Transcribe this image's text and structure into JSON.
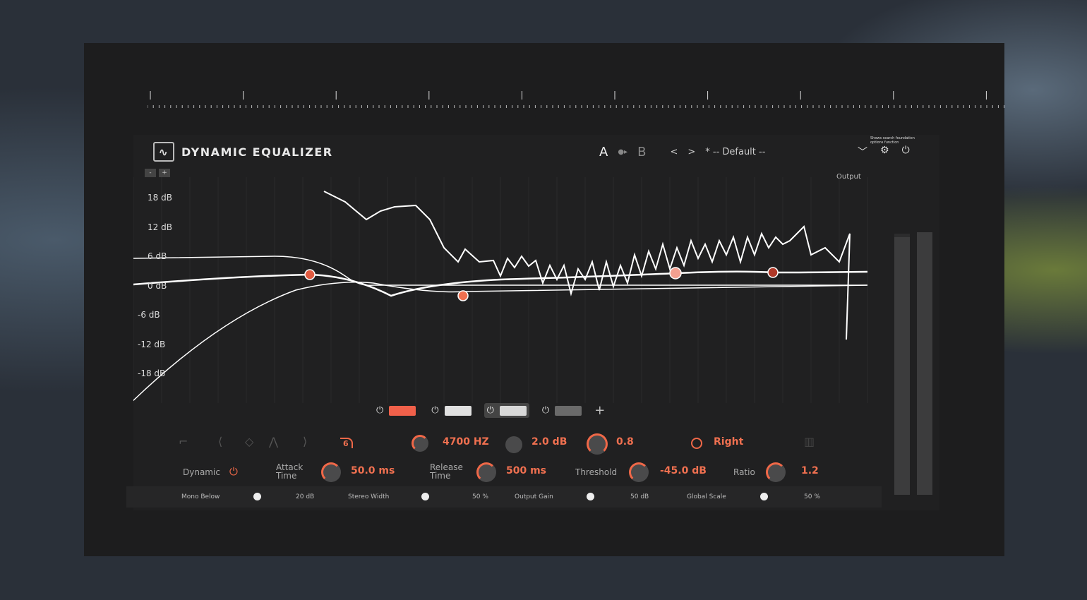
{
  "app": {
    "title": "DYNAMIC EQUALIZER",
    "logo_icon": "sine-wave-icon"
  },
  "zoom": {
    "minus": "-",
    "plus": "+"
  },
  "header": {
    "a_label": "A",
    "copy_icon": "copy-arrow",
    "b_label": "B",
    "prev": "<",
    "next": ">",
    "preset": "* -- Default --",
    "tooltip": "Shows search foundation options function"
  },
  "icons": {
    "collapse": "chevron-down-icon",
    "settings": "gear-icon",
    "power": "power-icon"
  },
  "output_label": "Output",
  "axis": {
    "labels": [
      "18 dB",
      "12 dB",
      "6 dB",
      "0 dB",
      "-6 dB",
      "-12 dB",
      "-18 dB"
    ]
  },
  "bands": [
    {
      "color": "#f0604a",
      "selected": false
    },
    {
      "color": "#e0e0e0",
      "selected": false
    },
    {
      "color": "#d8d8d8",
      "selected": true
    },
    {
      "color": "#6a6a6a",
      "selected": false
    }
  ],
  "add_band": "+",
  "band_params": {
    "filter_order": "6",
    "frequency": "4700 HZ",
    "gain": "2.0 dB",
    "q": "0.8",
    "channel": "Right"
  },
  "dynamics": {
    "dynamic_label": "Dynamic",
    "attack_label": "Attack Time",
    "attack": "50.0 ms",
    "release_label": "Release Time",
    "release": "500 ms",
    "threshold_label": "Threshold",
    "threshold": "-45.0 dB",
    "ratio_label": "Ratio",
    "ratio": "1.2"
  },
  "global": {
    "mono_below_label": "Mono Below",
    "mono_below": "20 dB",
    "stereo_width_label": "Stereo Width",
    "stereo_width": "50 %",
    "output_gain_label": "Output Gain",
    "output_gain": "50 dB",
    "global_scale_label": "Global Scale",
    "global_scale": "50 %"
  },
  "colors": {
    "accent": "#f06848",
    "background": "#1d1d1e"
  }
}
